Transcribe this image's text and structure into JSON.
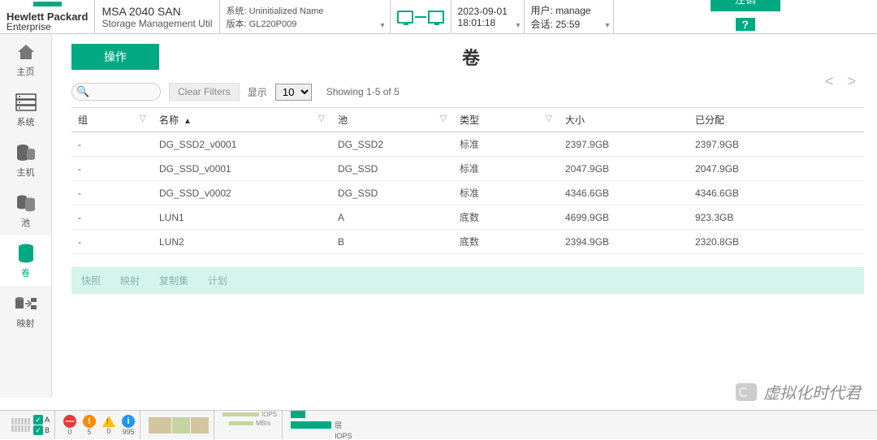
{
  "header": {
    "brand1": "Hewlett Packard",
    "brand2": "Enterprise",
    "product_name": "MSA 2040 SAN",
    "product_sub": "Storage Management Util",
    "sys_label": "系统:",
    "sys_value": "Uninitialized Name",
    "ver_label": "版本:",
    "ver_value": "GL220P009",
    "date": "2023-09-01",
    "time": "18:01:18",
    "user_label": "用户:",
    "user_value": "manage",
    "session_label": "会话:",
    "session_value": "25:59",
    "logout": "注销",
    "help": "?"
  },
  "nav": {
    "home": "主页",
    "system": "系统",
    "hosts": "主机",
    "pools": "池",
    "volumes": "卷",
    "mapping": "映射"
  },
  "page": {
    "ops": "操作",
    "title": "卷"
  },
  "filters": {
    "clear": "Clear Filters",
    "show_label": "显示",
    "show_value": "10",
    "showing": "Showing 1-5 of 5"
  },
  "columns": {
    "group": "组",
    "name": "名称",
    "pool": "池",
    "type": "类型",
    "size": "大小",
    "allocated": "已分配"
  },
  "rows": [
    {
      "group": "-",
      "name": "DG_SSD2_v0001",
      "pool": "DG_SSD2",
      "type": "标准",
      "size": "2397.9GB",
      "allocated": "2397.9GB"
    },
    {
      "group": "-",
      "name": "DG_SSD_v0001",
      "pool": "DG_SSD",
      "type": "标准",
      "size": "2047.9GB",
      "allocated": "2047.9GB"
    },
    {
      "group": "-",
      "name": "DG_SSD_v0002",
      "pool": "DG_SSD",
      "type": "标准",
      "size": "4346.6GB",
      "allocated": "4346.6GB"
    },
    {
      "group": "-",
      "name": "LUN1",
      "pool": "A",
      "type": "底数",
      "size": "4699.9GB",
      "allocated": "923.3GB"
    },
    {
      "group": "-",
      "name": "LUN2",
      "pool": "B",
      "type": "底数",
      "size": "2394.9GB",
      "allocated": "2320.8GB"
    }
  ],
  "subnav": {
    "snap": "快照",
    "map": "映射",
    "repl": "复制集",
    "plan": "计划"
  },
  "footer": {
    "a": "A",
    "b": "B",
    "err": "0",
    "warn1": "5",
    "warn2": "0",
    "info": "995",
    "iops": "IOPS",
    "mbs": "MB/s",
    "tier": "层"
  },
  "watermark": "虚拟化时代君"
}
